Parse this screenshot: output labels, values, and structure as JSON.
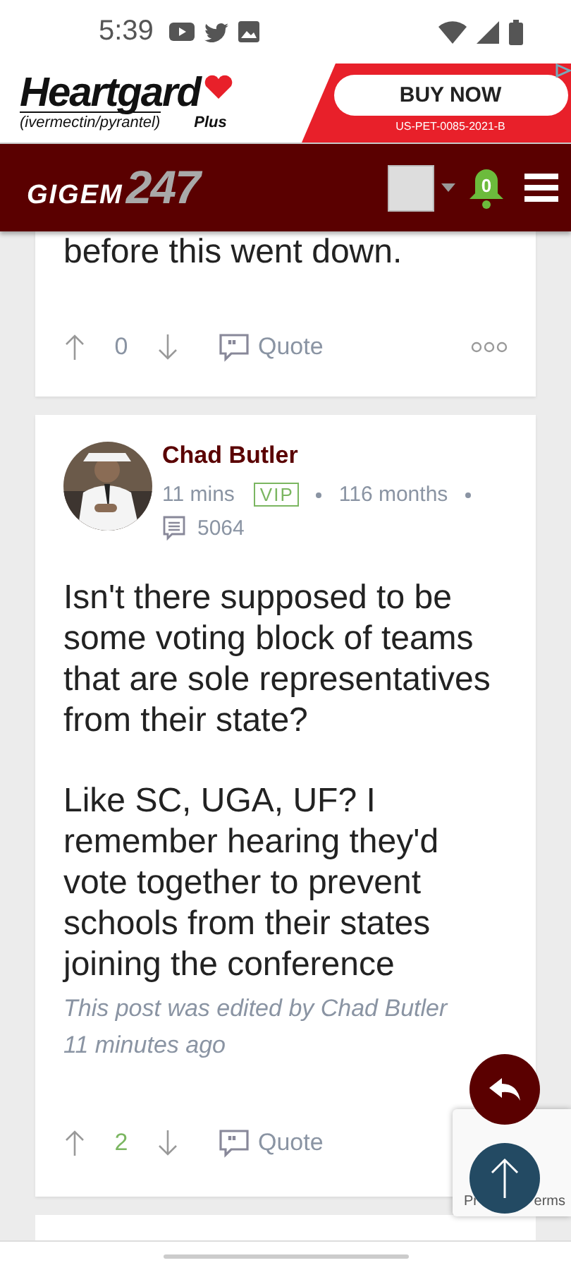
{
  "status_bar": {
    "time": "5:39"
  },
  "ad": {
    "brand": "Heartgard",
    "brand_suffix": "Plus",
    "ingredients": "(ivermectin/pyrantel)",
    "cta": "BUY NOW",
    "code": "US-PET-0085-2021-B"
  },
  "header": {
    "logo_word": "GIGEM",
    "logo_number": "247",
    "notifications": "0"
  },
  "posts": [
    {
      "kind": "partial",
      "body": [
        "before this went down."
      ],
      "votes": "0",
      "positive": false,
      "quote": "Quote"
    },
    {
      "kind": "full",
      "author": "Chad Butler",
      "time": "11 mins",
      "badge": "VIP",
      "tenure": "116 months",
      "post_count": "5064",
      "body": [
        "Isn't there supposed to be some voting block of teams that are sole representatives from their state?",
        "Like SC, UGA, UF? I remember hearing they'd vote together to prevent schools from their states joining the conference"
      ],
      "edited": "This post was edited by Chad Butler 11 minutes ago",
      "votes": "2",
      "positive": true,
      "quote": "Quote"
    }
  ],
  "recaptcha": {
    "text_left": "Pr",
    "text_right": "erms"
  }
}
